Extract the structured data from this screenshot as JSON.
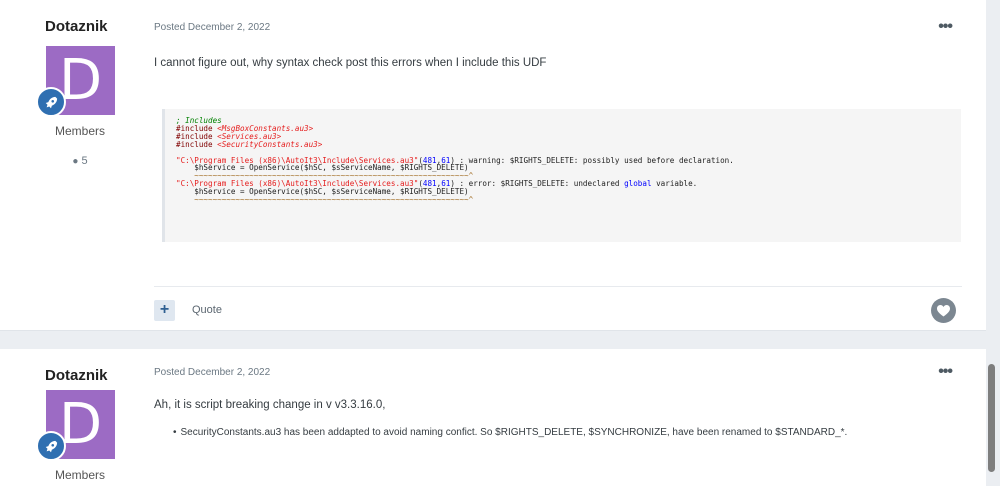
{
  "posts": [
    {
      "author": "Dotaznik",
      "avatar_letter": "D",
      "group": "Members",
      "post_count": "5",
      "posted": "Posted December 2, 2022",
      "text": "I cannot figure out, why syntax check post this errors when I include this UDF",
      "quote_label": "Quote",
      "code": {
        "comment": "; Includes",
        "include_kw": "#include",
        "includes": [
          "<MsgBoxConstants.au3>",
          "<Services.au3>",
          "<SecurityConstants.au3>"
        ],
        "path": "\"C:\\Program Files (x86)\\AutoIt3\\Include\\Services.au3\"",
        "lp": "(",
        "num_a": "481",
        "comma": ",",
        "num_b": "61",
        "rp": ")",
        "warn_msg": " : warning: $RIGHTS_DELETE: possibly used before declaration.",
        "stmt": "    $hService = OpenService($hSC, $sServiceName, $RIGHTS_DELETE)",
        "tilde": "    ~~~~~~~~~~~~~~~~~~~~~~~~~~~~~~~~~~~~~~~~~~~~~~~~~~~~~~~~~~~~^",
        "err_msg_a": " : error: $RIGHTS_DELETE: undeclared ",
        "err_kw": "global",
        "err_msg_b": " variable."
      }
    },
    {
      "author": "Dotaznik",
      "avatar_letter": "D",
      "group": "Members",
      "posted": "Posted December 2, 2022",
      "text": "Ah, it is script breaking change in v v3.3.16.0,",
      "bullet": "SecurityConstants.au3 has been addapted to avoid naming confict. So $RIGHTS_DELETE, $SYNCHRONIZE, have been renamed to $STANDARD_*."
    }
  ],
  "icons": {
    "more": "•••",
    "rank": "rocket-icon",
    "comment": "speech-bubble-icon",
    "plus": "+",
    "like": "heart-icon"
  },
  "colors": {
    "avatar": "#9c6bc4",
    "rank_badge": "#2f6fb1",
    "accent": "#2e5f91"
  }
}
